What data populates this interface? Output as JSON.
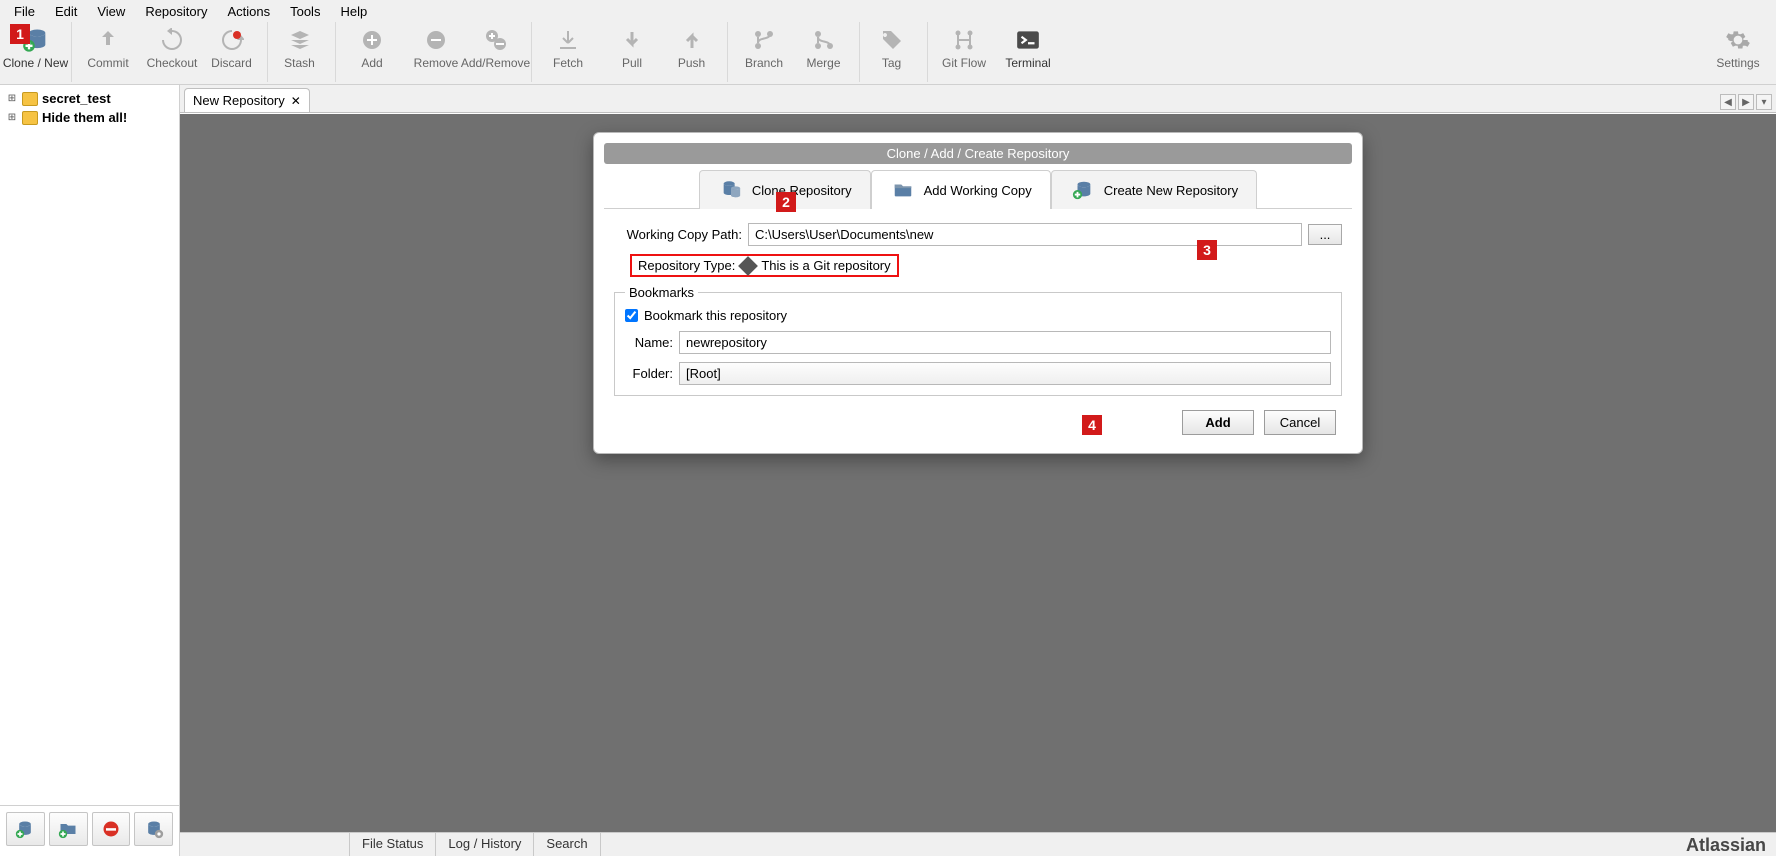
{
  "menu": {
    "items": [
      "File",
      "Edit",
      "View",
      "Repository",
      "Actions",
      "Tools",
      "Help"
    ]
  },
  "toolbar": {
    "items": [
      {
        "id": "clone-new",
        "label": "Clone / New",
        "enabled": true,
        "sep": true
      },
      {
        "id": "commit",
        "label": "Commit",
        "enabled": false
      },
      {
        "id": "checkout",
        "label": "Checkout",
        "enabled": false
      },
      {
        "id": "discard",
        "label": "Discard",
        "enabled": false,
        "sep": true
      },
      {
        "id": "stash",
        "label": "Stash",
        "enabled": false,
        "sep": true
      },
      {
        "id": "add",
        "label": "Add",
        "enabled": false
      },
      {
        "id": "remove",
        "label": "Remove",
        "enabled": false
      },
      {
        "id": "add-remove",
        "label": "Add/Remove",
        "enabled": false,
        "sep": true
      },
      {
        "id": "fetch",
        "label": "Fetch",
        "enabled": false
      },
      {
        "id": "pull",
        "label": "Pull",
        "enabled": false
      },
      {
        "id": "push",
        "label": "Push",
        "enabled": false,
        "sep": true
      },
      {
        "id": "branch",
        "label": "Branch",
        "enabled": false
      },
      {
        "id": "merge",
        "label": "Merge",
        "enabled": false,
        "sep": true
      },
      {
        "id": "tag",
        "label": "Tag",
        "enabled": false,
        "sep": true
      },
      {
        "id": "git-flow",
        "label": "Git Flow",
        "enabled": false
      },
      {
        "id": "terminal",
        "label": "Terminal",
        "enabled": true
      }
    ],
    "settings_label": "Settings"
  },
  "sidebar": {
    "items": [
      {
        "label": "secret_test"
      },
      {
        "label": "Hide them all!"
      }
    ]
  },
  "tabs": {
    "items": [
      {
        "label": "New Repository"
      }
    ]
  },
  "status": {
    "items": [
      "File Status",
      "Log / History",
      "Search"
    ],
    "brand": "Atlassian"
  },
  "dialog": {
    "title": "Clone  / Add / Create Repository",
    "tabs": [
      {
        "id": "clone",
        "label": "Clone Repository"
      },
      {
        "id": "add",
        "label": "Add Working Copy",
        "active": true
      },
      {
        "id": "create",
        "label": "Create New Repository"
      }
    ],
    "path_label": "Working Copy Path:",
    "path_value": "C:\\Users\\User\\Documents\\new",
    "browse": "...",
    "type_label": "Repository Type:",
    "type_value": "This is a Git repository",
    "bookmarks_legend": "Bookmarks",
    "bookmark_checkbox": "Bookmark this repository",
    "name_label": "Name:",
    "name_value": "newrepository",
    "folder_label": "Folder:",
    "folder_value": "[Root]",
    "add_btn": "Add",
    "cancel_btn": "Cancel"
  },
  "markers": {
    "m1": "1",
    "m2": "2",
    "m3": "3",
    "m4": "4"
  }
}
